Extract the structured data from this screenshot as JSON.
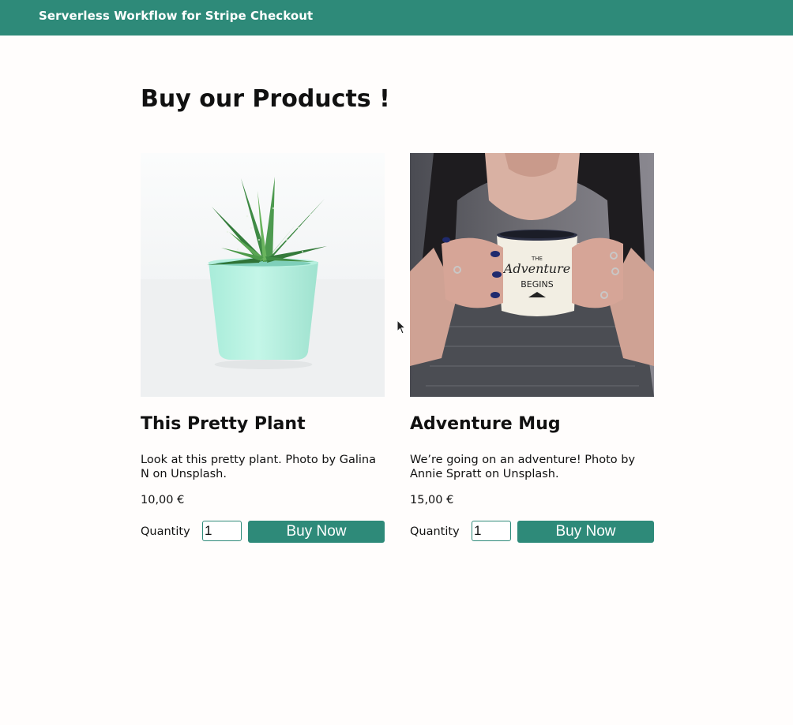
{
  "header": {
    "title": "Serverless Workflow for Stripe Checkout",
    "color": "#2e8a79"
  },
  "main": {
    "title": "Buy our Products !"
  },
  "products": [
    {
      "name": "This Pretty Plant",
      "description": "Look at this pretty plant. Photo by Galina N on Unsplash.",
      "price": "10,00 €",
      "quantity_label": "Quantity",
      "quantity_value": "1",
      "buy_label": "Buy Now",
      "image": "potted-succulent-photo"
    },
    {
      "name": "Adventure Mug",
      "description": "We’re going on an adventure! Photo by Annie Spratt on Unsplash.",
      "price": "15,00 €",
      "quantity_label": "Quantity",
      "quantity_value": "1",
      "buy_label": "Buy Now",
      "image": "adventure-mug-photo",
      "image_text": [
        "THE",
        "Adventure",
        "BEGINS"
      ]
    }
  ]
}
